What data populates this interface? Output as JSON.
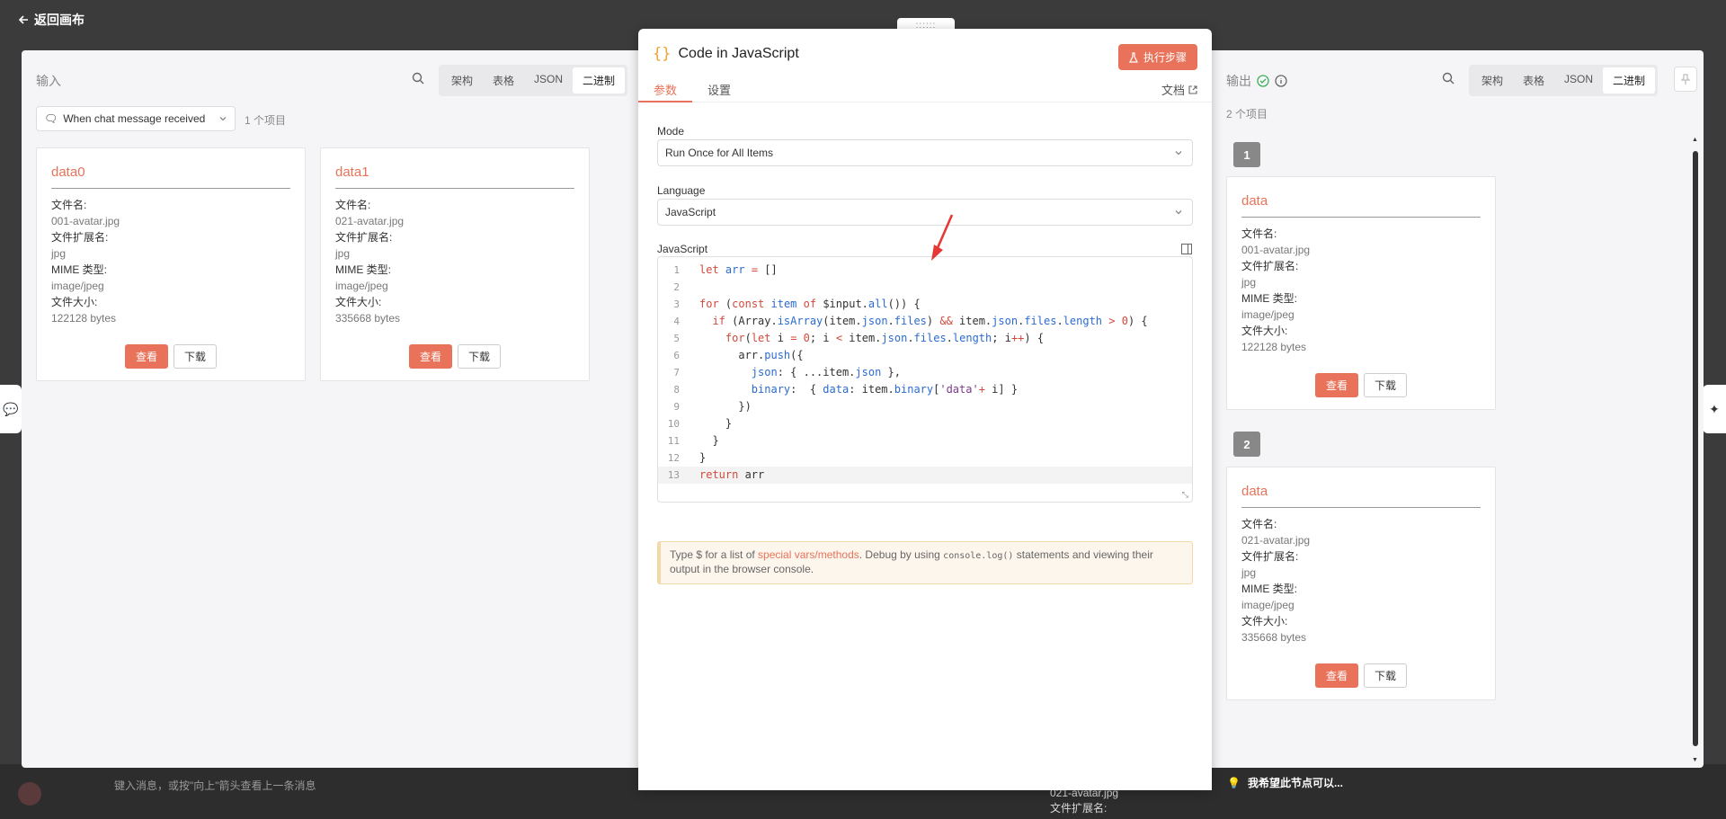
{
  "topbar": {
    "back_label": "返回画布"
  },
  "background": {
    "message_placeholder": "键入消息，或按\"向上\"箭头查看上一条消息",
    "under_text_1": "021-avatar.jpg",
    "under_text_2": "文件扩展名:",
    "hint_text": "我希望此节点可以..."
  },
  "input_panel": {
    "title": "输入",
    "view_modes": [
      "架构",
      "表格",
      "JSON",
      "二进制"
    ],
    "active_mode": "二进制",
    "trigger_select": "When chat message received",
    "item_count": "1 个项目",
    "cards": [
      {
        "title": "data0",
        "fields": [
          {
            "key": "文件名:",
            "value": "001-avatar.jpg"
          },
          {
            "key": "文件扩展名:",
            "value": "jpg"
          },
          {
            "key": "MIME 类型:",
            "value": "image/jpeg"
          },
          {
            "key": "文件大小:",
            "value": "122128 bytes"
          }
        ],
        "view_label": "查看",
        "download_label": "下载"
      },
      {
        "title": "data1",
        "fields": [
          {
            "key": "文件名:",
            "value": "021-avatar.jpg"
          },
          {
            "key": "文件扩展名:",
            "value": "jpg"
          },
          {
            "key": "MIME 类型:",
            "value": "image/jpeg"
          },
          {
            "key": "文件大小:",
            "value": "335668 bytes"
          }
        ],
        "view_label": "查看",
        "download_label": "下载"
      }
    ]
  },
  "dialog": {
    "title": "Code in JavaScript",
    "execute_label": "执行步骤",
    "tabs": [
      "参数",
      "设置"
    ],
    "active_tab": "参数",
    "docs_label": "文档",
    "mode_label": "Mode",
    "mode_value": "Run Once for All Items",
    "language_label": "Language",
    "language_value": "JavaScript",
    "editor_label": "JavaScript",
    "code_lines": [
      "let arr = []",
      "",
      "for (const item of $input.all()) {",
      "  if (Array.isArray(item.json.files) && item.json.files.length > 0) {",
      "    for(let i = 0; i < item.json.files.length; i++) {",
      "      arr.push({",
      "        json: { ...item.json },",
      "        binary:  { data: item.binary['data'+ i] }",
      "      })",
      "    }",
      "  }",
      "}",
      "return arr"
    ],
    "hint": {
      "prefix": "Type $ for a list of ",
      "link": "special vars/methods",
      "middle": ". Debug by using ",
      "code": "console.log()",
      "suffix": " statements and viewing their output in the browser console."
    }
  },
  "output_panel": {
    "title": "输出",
    "view_modes": [
      "架构",
      "表格",
      "JSON",
      "二进制"
    ],
    "active_mode": "二进制",
    "item_count": "2 个项目",
    "items": [
      {
        "index": "1",
        "title": "data",
        "fields": [
          {
            "key": "文件名:",
            "value": "001-avatar.jpg"
          },
          {
            "key": "文件扩展名:",
            "value": "jpg"
          },
          {
            "key": "MIME 类型:",
            "value": "image/jpeg"
          },
          {
            "key": "文件大小:",
            "value": "122128 bytes"
          }
        ],
        "view_label": "查看",
        "download_label": "下载"
      },
      {
        "index": "2",
        "title": "data",
        "fields": [
          {
            "key": "文件名:",
            "value": "021-avatar.jpg"
          },
          {
            "key": "文件扩展名:",
            "value": "jpg"
          },
          {
            "key": "MIME 类型:",
            "value": "image/jpeg"
          },
          {
            "key": "文件大小:",
            "value": "335668 bytes"
          }
        ],
        "view_label": "查看",
        "download_label": "下载"
      }
    ]
  },
  "colors": {
    "accent": "#e8735a",
    "success": "#3fae5a",
    "annotation": "#e53935"
  }
}
